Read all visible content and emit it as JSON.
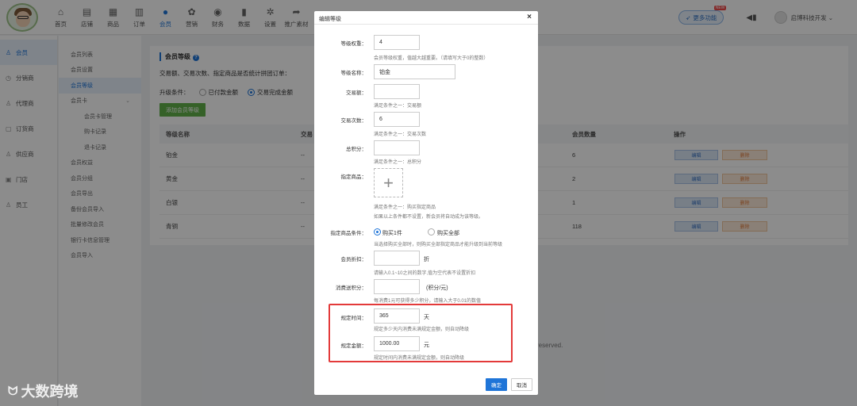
{
  "nav": {
    "items": [
      {
        "icon": "home-icon",
        "glyph": "⌂",
        "label": "首页"
      },
      {
        "icon": "shop-icon",
        "glyph": "▤",
        "label": "店铺"
      },
      {
        "icon": "goods-icon",
        "glyph": "▦",
        "label": "商品"
      },
      {
        "icon": "order-icon",
        "glyph": "▥",
        "label": "订单"
      },
      {
        "icon": "member-icon",
        "glyph": "●",
        "label": "会员"
      },
      {
        "icon": "marketing-icon",
        "glyph": "✿",
        "label": "营销"
      },
      {
        "icon": "finance-icon",
        "glyph": "◉",
        "label": "财务"
      },
      {
        "icon": "data-icon",
        "glyph": "▮",
        "label": "数据"
      },
      {
        "icon": "settings-icon",
        "glyph": "✲",
        "label": "设置"
      },
      {
        "icon": "promotion-icon",
        "glyph": "➦",
        "label": "推广素材"
      }
    ],
    "active_index": 4,
    "more_label": "更多功能",
    "new_badge": "NEW",
    "username": "启博科技开发"
  },
  "sidebar1": {
    "items": [
      {
        "icon": "user-icon",
        "glyph": "♙",
        "label": "会员"
      },
      {
        "icon": "distributor-icon",
        "glyph": "◷",
        "label": "分销商"
      },
      {
        "icon": "agent-icon",
        "glyph": "♙",
        "label": "代理商"
      },
      {
        "icon": "ordering-icon",
        "glyph": "▢",
        "label": "订货商"
      },
      {
        "icon": "supplier-icon",
        "glyph": "♙",
        "label": "供应商"
      },
      {
        "icon": "store-icon",
        "glyph": "▣",
        "label": "门店"
      },
      {
        "icon": "staff-icon",
        "glyph": "♙",
        "label": "员工"
      }
    ]
  },
  "sidebar2": {
    "items": [
      {
        "label": "会员列表",
        "sub": false
      },
      {
        "label": "会员设置",
        "sub": false
      },
      {
        "label": "会员等级",
        "sub": false
      },
      {
        "label": "会员卡",
        "sub": false
      },
      {
        "label": "会员卡管理",
        "sub": true
      },
      {
        "label": "购卡记录",
        "sub": true
      },
      {
        "label": "退卡记录",
        "sub": true
      },
      {
        "label": "会员权益",
        "sub": false
      },
      {
        "label": "会员分组",
        "sub": false
      },
      {
        "label": "会员导出",
        "sub": false
      },
      {
        "label": "备份会员导入",
        "sub": false
      },
      {
        "label": "批量修改会员",
        "sub": false
      },
      {
        "label": "银行卡信息管理",
        "sub": false
      },
      {
        "label": "会员导入",
        "sub": false
      }
    ]
  },
  "main": {
    "title": "会员等级",
    "question": "交易额、交易次数、指定商品是否统计拼团订单：",
    "upgrade_label": "升级条件：",
    "upgrade_opt1": "已付款金额",
    "upgrade_opt2": "交易完成金额",
    "add_button": "添加会员等级",
    "table": {
      "headers": [
        "等级名称",
        "交易",
        "会员数量",
        "操作"
      ],
      "rows": [
        {
          "name": "铂金",
          "trade": "--",
          "count": "6"
        },
        {
          "name": "黄金",
          "trade": "--",
          "count": "2"
        },
        {
          "name": "白银",
          "trade": "--",
          "count": "1"
        },
        {
          "name": "青铜",
          "trade": "--",
          "count": "118"
        }
      ],
      "edit_label": "编辑",
      "delete_label": "删除"
    },
    "footer": "reserved."
  },
  "modal": {
    "title": "编辑等级",
    "close": "×",
    "weight_label": "等级权重：",
    "weight_value": "4",
    "weight_hint": "会员等级权重，值越大越重要。（请填写大于0的整数）",
    "name_label": "等级名称：",
    "name_value": "铂金",
    "amount_label": "交易额：",
    "amount_value": "",
    "amount_hint": "满足条件之一：交易额",
    "times_label": "交易次数：",
    "times_value": "6",
    "times_hint": "满足条件之一：交易次数",
    "points_label": "总积分：",
    "points_value": "",
    "points_hint": "满足条件之一：总积分",
    "goods_label": "指定商品：",
    "goods_hint1": "满足条件之一：购买指定商品",
    "goods_hint2": "如果以上条件都不设置，新会员将自动成为该等级。",
    "cond_label": "指定商品条件：",
    "cond_opt1": "购买1件",
    "cond_opt2": "购买全部",
    "cond_hint": "当选择购买全部时，则购买全部指定商品才能升级到当前等级",
    "discount_label": "会员折扣：",
    "discount_value": "",
    "discount_unit": "折",
    "discount_hint": "请输入0.1~10之间的数字,值为空代表不设置折扣",
    "consume_label": "消费送积分：",
    "consume_value": "",
    "consume_unit": "(积分/元)",
    "consume_hint": "每消费1元可获得多少积分，请输入大于0.01的数值",
    "time_label": "规定时间：",
    "time_value": "365",
    "time_unit": "天",
    "time_hint": "规定多少天内消费未满规定金额，则自动降级",
    "money_label": "规定金额：",
    "money_value": "1000.00",
    "money_unit": "元",
    "money_hint": "规定时间内消费未满规定金额，则自动降级",
    "ok": "确定",
    "cancel": "取消"
  },
  "watermark": "大数跨境"
}
